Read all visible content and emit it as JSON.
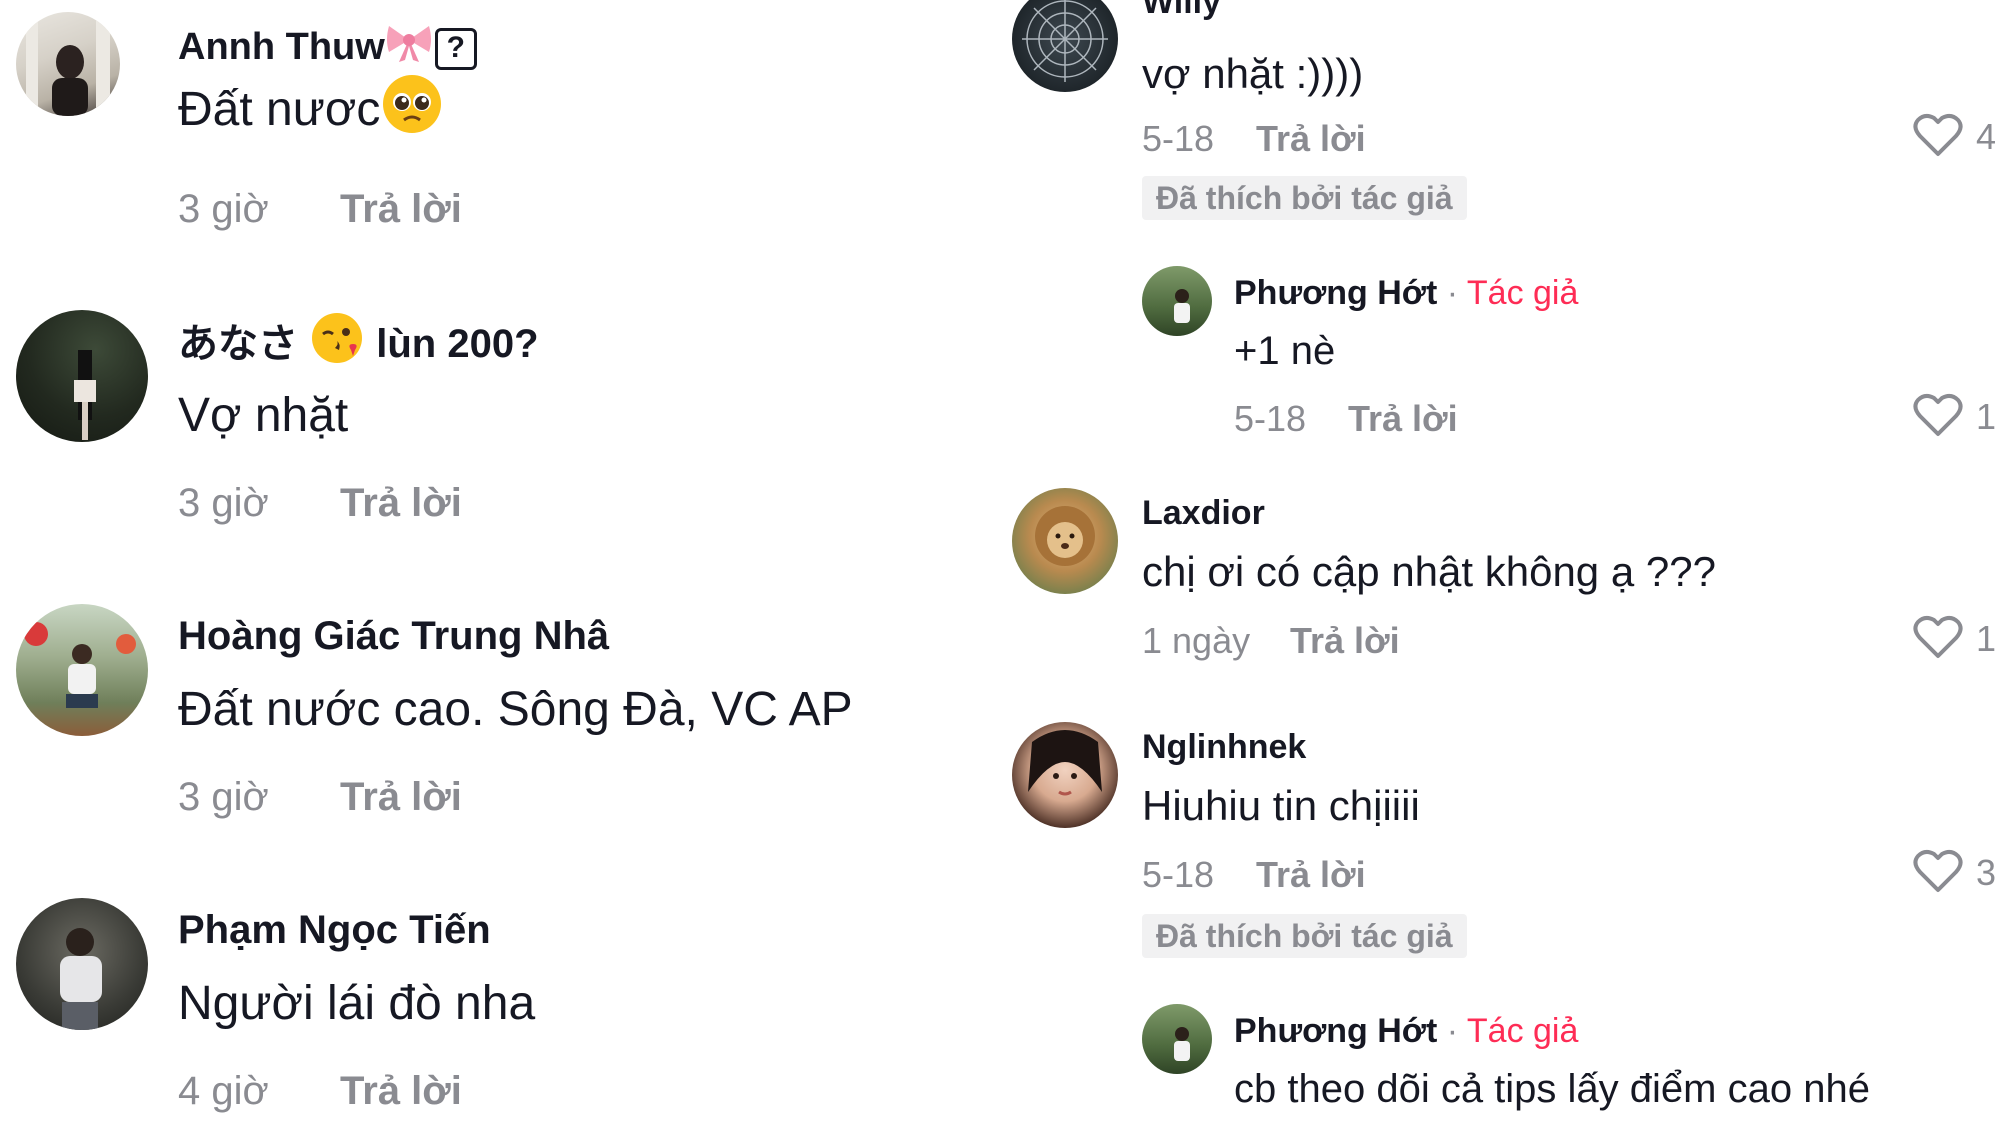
{
  "left_comments": [
    {
      "name": "Annh Thuw",
      "text": "Đất nươc",
      "time": "3 giờ",
      "reply": "Trả lời"
    },
    {
      "name_prefix": "あなさ",
      "name_suffix": "lùn 200?",
      "text": "Vợ nhặt",
      "time": "3 giờ",
      "reply": "Trả lời"
    },
    {
      "name": "Hoàng Giác Trung Nhâ",
      "text": "Đất nước cao. Sông Đà, VC AP",
      "time": "3 giờ",
      "reply": "Trả lời"
    },
    {
      "name": "Phạm Ngọc Tiến",
      "text": "Người lái đò nha",
      "time": "4 giờ",
      "reply": "Trả lời"
    }
  ],
  "right_comments": [
    {
      "name": "Willy",
      "text": "vợ nhặt :))))",
      "time": "5-18",
      "reply": "Trả lời",
      "likes": "4",
      "liked_by_author": "Đã thích bởi tác giả"
    },
    {
      "name": "Phương Hớt",
      "author_tag": "Tác giả",
      "text": "+1 nè",
      "time": "5-18",
      "reply": "Trả lời",
      "likes": "1"
    },
    {
      "name": "Laxdior",
      "text": "chị ơi có cập nhật không ạ ???",
      "time": "1 ngày",
      "reply": "Trả lời",
      "likes": "1"
    },
    {
      "name": "Nglinhnek",
      "text": "Hiuhiu tin chịiiii",
      "time": "5-18",
      "reply": "Trả lời",
      "likes": "3",
      "liked_by_author": "Đã thích bởi tác giả"
    },
    {
      "name": "Phương Hớt",
      "author_tag": "Tác giả",
      "text": "cb theo dõi cả tips lấy điểm cao nhé"
    }
  ],
  "colors": {
    "accent": "#fe2c55",
    "muted": "#8a8b91",
    "text": "#161823",
    "badge_bg": "#f1f1f2"
  },
  "icons": {
    "like": "heart-outline-icon",
    "unknown_char": "question-box-icon",
    "bow": "ribbon-bow-emoji",
    "pleading": "pleading-face-emoji",
    "kiss": "face-blowing-kiss-emoji"
  }
}
